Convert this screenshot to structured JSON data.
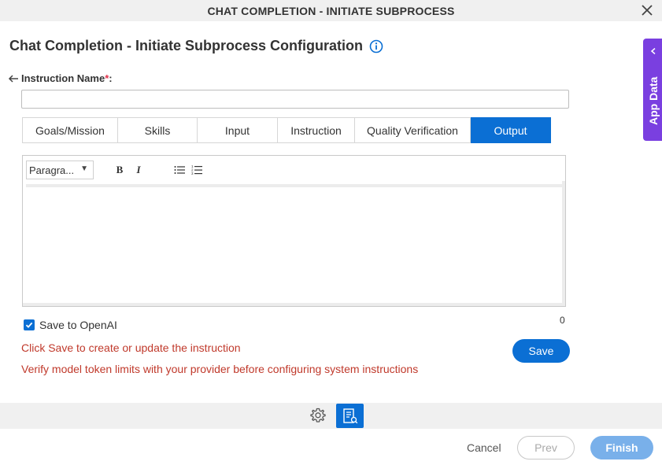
{
  "window": {
    "title": "CHAT COMPLETION - INITIATE SUBPROCESS"
  },
  "page": {
    "heading": "Chat Completion - Initiate Subprocess Configuration"
  },
  "instruction": {
    "label": "Instruction Name",
    "required_mark": "*",
    "colon": ":",
    "value": "",
    "placeholder": ""
  },
  "tabs": [
    {
      "label": "Goals/Mission",
      "active": false
    },
    {
      "label": "Skills",
      "active": false
    },
    {
      "label": "Input",
      "active": false
    },
    {
      "label": "Instruction",
      "active": false
    },
    {
      "label": "Quality Verification",
      "active": false
    },
    {
      "label": "Output",
      "active": true
    }
  ],
  "editor": {
    "paragraph_select": "Paragra...",
    "bold": "B",
    "italic": "I",
    "content": ""
  },
  "char_count": "0",
  "save_to_openai": {
    "label": "Save to OpenAI",
    "checked": true
  },
  "messages": {
    "line1": "Click Save to create or update the instruction",
    "line2": "Verify model token limits with your provider before configuring system instructions"
  },
  "buttons": {
    "save": "Save",
    "cancel": "Cancel",
    "prev": "Prev",
    "finish": "Finish"
  },
  "side_panel": {
    "label": "App Data"
  },
  "colors": {
    "accent": "#0b6fd4",
    "side_panel": "#7a3fe0",
    "message": "#c0392b",
    "finish_disabled": "#79b0ea"
  },
  "icons": {
    "close": "close-icon",
    "info": "info-icon",
    "back": "arrow-left-icon",
    "gear": "gear-icon",
    "properties": "properties-icon",
    "chevron": "chevron-left-icon"
  }
}
